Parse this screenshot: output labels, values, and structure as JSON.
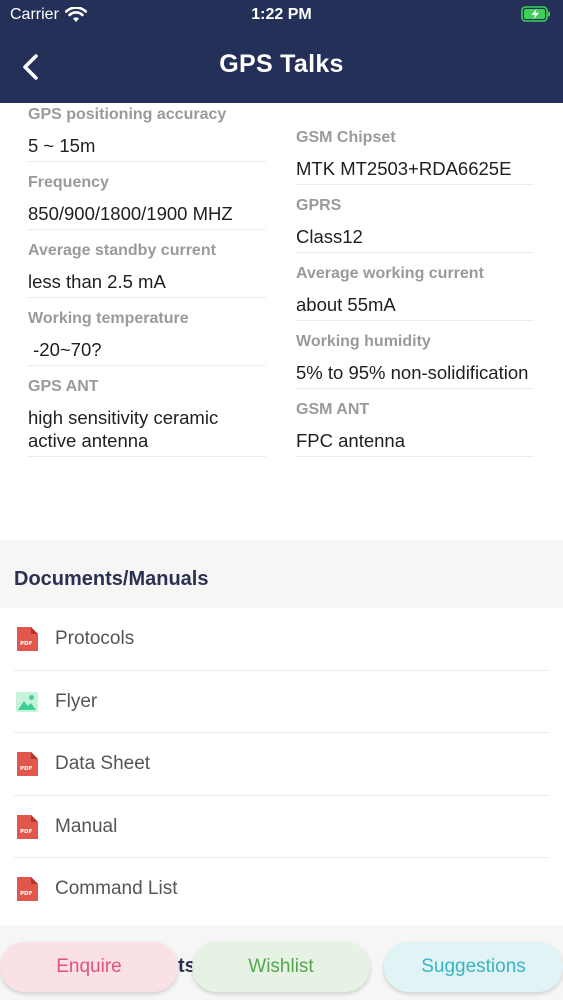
{
  "status_bar": {
    "carrier": "Carrier",
    "time": "1:22 PM",
    "battery_icon": "charging-battery-icon",
    "wifi_icon": "wifi-icon"
  },
  "nav": {
    "title": "GPS Talks",
    "back_icon": "chevron-left-icon"
  },
  "specs": {
    "left": [
      {
        "label": "GPS positioning accuracy",
        "value": "5 ~ 15m"
      },
      {
        "label": "Frequency",
        "value": "850/900/1800/1900 MHZ"
      },
      {
        "label": "Average standby current",
        "value": "less than 2.5 mA"
      },
      {
        "label": "Working temperature",
        "value": " -20~70?"
      },
      {
        "label": "GPS ANT",
        "value": "high sensitivity ceramic active antenna"
      }
    ],
    "right": [
      {
        "label": "GSM Chipset",
        "value": "MTK MT2503+RDA6625E"
      },
      {
        "label": "GPRS",
        "value": "Class12"
      },
      {
        "label": "Average working current",
        "value": "about 55mA"
      },
      {
        "label": "Working humidity",
        "value": "5% to 95% non-solidification"
      },
      {
        "label": "GSM ANT",
        "value": "FPC antenna"
      }
    ]
  },
  "documents": {
    "title": "Documents/Manuals",
    "items": [
      {
        "label": "Protocols",
        "icon": "pdf-file-icon"
      },
      {
        "label": "Flyer",
        "icon": "image-file-icon"
      },
      {
        "label": "Data Sheet",
        "icon": "pdf-file-icon"
      },
      {
        "label": "Manual",
        "icon": "pdf-file-icon"
      },
      {
        "label": "Command List",
        "icon": "pdf-file-icon"
      }
    ]
  },
  "partial_heading": "ts",
  "actions": {
    "enquire": "Enquire",
    "wishlist": "Wishlist",
    "suggestions": "Suggestions"
  },
  "colors": {
    "header_bg": "#243057",
    "pdf_red": "#e2574c",
    "image_green": "#3fcf8e",
    "enquire": "#e24b72",
    "wishlist": "#4ea14a",
    "suggestions": "#2fb1c2"
  }
}
